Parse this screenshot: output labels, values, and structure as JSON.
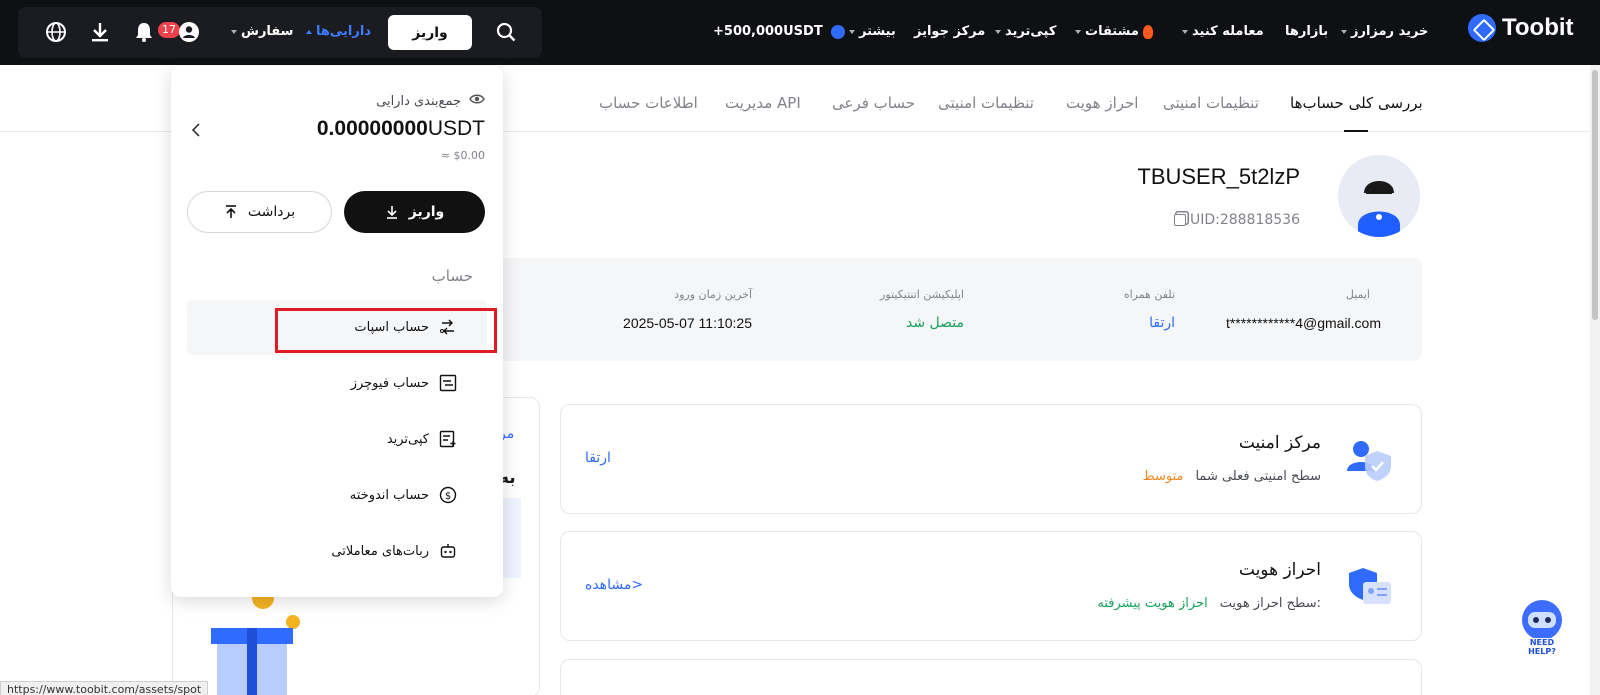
{
  "topbar": {
    "brand": "Toobit",
    "nav": {
      "buy_crypto": "خرید رمزارز",
      "markets": "بازارها",
      "trade": "معامله کنید",
      "derivatives": "مشتقات",
      "copy_trade": "کپی‌ترید",
      "rewards": "مرکز جوایز",
      "more": "بیشتر",
      "promo": "+500,000USDT"
    },
    "deposit_button": "واریز",
    "assets_menu": "دارایی‌ها",
    "orders_menu": "سفارش",
    "notification_count": "17"
  },
  "tabs": [
    {
      "label": "بررسی کلی حساب‌ها",
      "active": true
    },
    {
      "label": "تنظیمات امنیتی",
      "active": false
    },
    {
      "label": "احراز هویت",
      "active": false
    },
    {
      "label": "تنظیمات امنیتی",
      "active": false
    },
    {
      "label": "حساب فرعی",
      "active": false
    },
    {
      "label": "مدیریت API",
      "active": false
    },
    {
      "label": "اطلاعات حساب",
      "active": false
    }
  ],
  "profile": {
    "username": "TBUSER_5t2lzP",
    "uid": "UID:288818536"
  },
  "info": {
    "email_label": "ایمیل",
    "email_value": "t************4@gmail.com",
    "phone_label": "تلفن همراه",
    "phone_value": "ارتقا",
    "auth_label": "اپلیکیشن اتنتیکیتور",
    "auth_value": "متصل شد",
    "last_login_label": "آخرین زمان ورود",
    "last_login_value": "2025-05-07 11:10:25"
  },
  "cards": {
    "security": {
      "title": "مرکز امنیت",
      "sub_label": "سطح امنیتی فعلی شما",
      "sub_value": "متوسط",
      "link": "ارتقا"
    },
    "identity": {
      "title": "احراز هویت",
      "sub_label": "سطح احراز هویت:",
      "sub_value": "احراز هویت پیشرفته",
      "link": "مشاهده>"
    }
  },
  "left_panel": {
    "partial_link": "مر",
    "partial_heading": "به"
  },
  "dropdown": {
    "summary_label": "جمع‌بندی دارایی",
    "balance_amount": "0.00000000",
    "balance_unit": "USDT",
    "fiat_value": "≈ $0.00",
    "deposit": "واریز",
    "withdraw": "برداشت",
    "section_title": "حساب",
    "items": [
      {
        "label": "حساب اسپات"
      },
      {
        "label": "حساب فیوچرز"
      },
      {
        "label": "کپی‌ترید"
      },
      {
        "label": "حساب اندوخته"
      },
      {
        "label": "ربات‌های معاملاتی"
      }
    ]
  },
  "status_url": "https://www.toobit.com/assets/spot",
  "help": "NEED HELP?",
  "colors": {
    "accent": "#2f6bff",
    "topbar_bg": "#0f1014",
    "highlight_border": "#e01b24",
    "success": "#19a15c",
    "warning": "#f08a24"
  }
}
